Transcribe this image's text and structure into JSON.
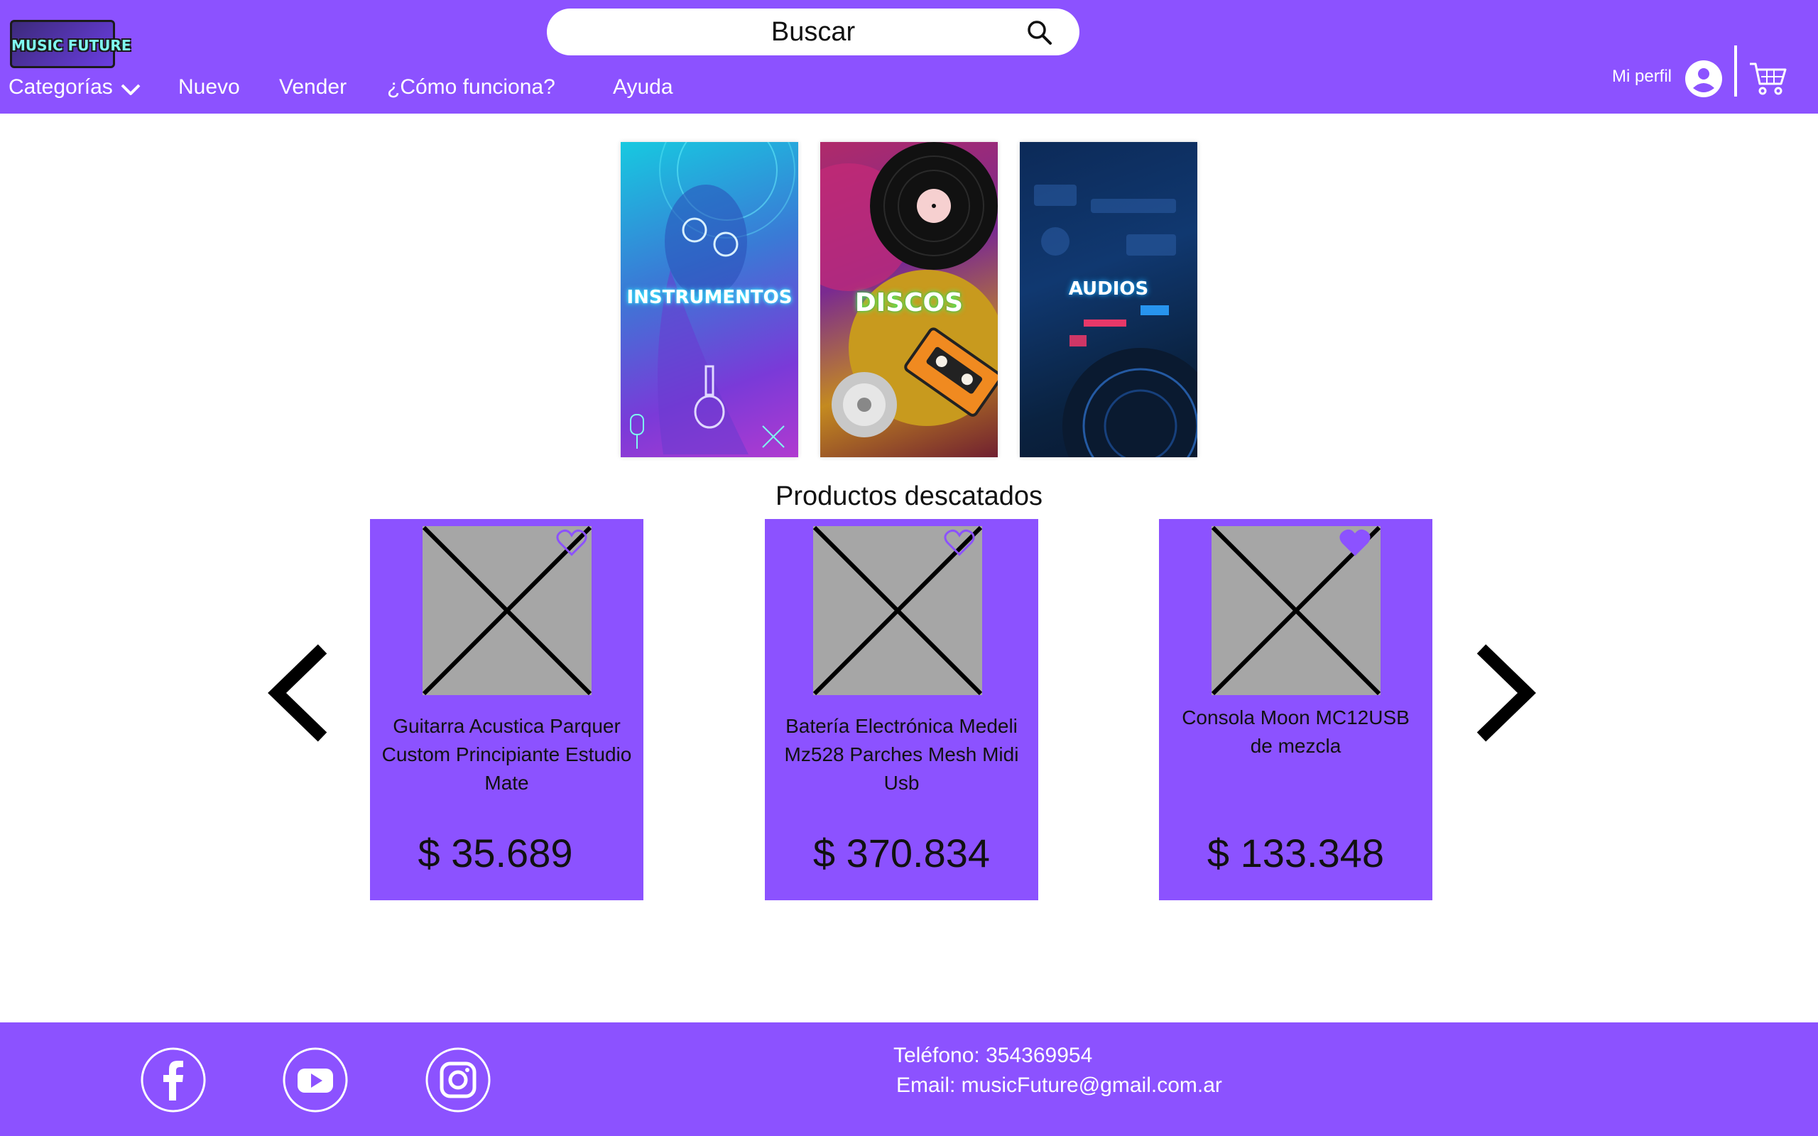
{
  "header": {
    "logo_text": "MUSIC FUTURE",
    "search": {
      "placeholder": "Buscar"
    },
    "nav": [
      {
        "label": "Categorías"
      },
      {
        "label": "Nuevo"
      },
      {
        "label": "Vender"
      },
      {
        "label": "¿Cómo funciona?"
      },
      {
        "label": "Ayuda"
      }
    ],
    "profile_label": "Mi perfil"
  },
  "categories": [
    {
      "label": "INSTRUMENTOS"
    },
    {
      "label": "DISCOS"
    },
    {
      "label": "AUDIOS"
    }
  ],
  "featured": {
    "title": "Productos descatados",
    "products": [
      {
        "name": "Guitarra Acustica Parquer Custom Principiante Estudio Mate",
        "price": "$ 35.689",
        "favorite": false
      },
      {
        "name": "Batería Electrónica Medeli Mz528 Parches Mesh Midi Usb",
        "price": "$ 370.834",
        "favorite": false
      },
      {
        "name": "Consola Moon MC12USB de mezcla",
        "price": "$ 133.348",
        "favorite": true
      }
    ]
  },
  "footer": {
    "phone": "Teléfono: 354369954",
    "email": "Email: musicFuture@gmail.com.ar"
  },
  "colors": {
    "brand": "#8c52ff",
    "placeholder_image": "#a6a6a6"
  },
  "icons": [
    "search-icon",
    "chevron-down-icon",
    "user-icon",
    "cart-icon",
    "arrow-left-icon",
    "arrow-right-icon",
    "heart-icon",
    "facebook-icon",
    "youtube-icon",
    "instagram-icon"
  ]
}
